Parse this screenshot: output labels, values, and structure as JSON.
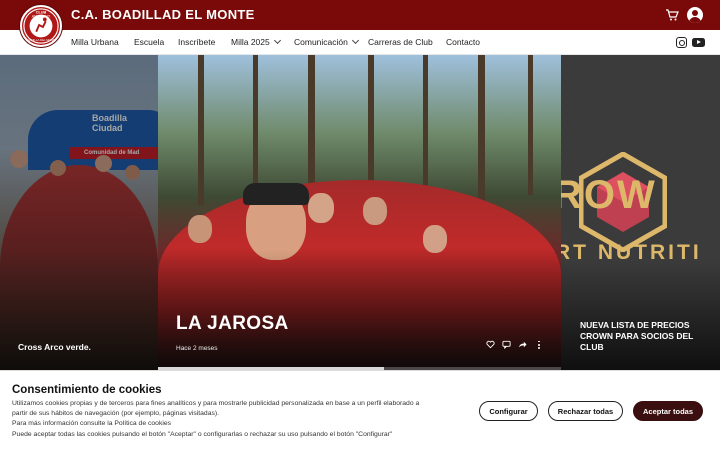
{
  "header": {
    "site_title": "C.A. BOADILLAD EL MONTE",
    "logo_name": "club-logo",
    "logo_text_top": "CLUB",
    "logo_text_mid": "ATLETISMO",
    "logo_text_bottom": "BOADILLA DEL MONTE",
    "cart_icon": "cart-icon",
    "user_icon": "user-account-icon",
    "colors": {
      "primary": "#7a0a0a",
      "nav_bg": "#ffffff"
    }
  },
  "nav": {
    "items": [
      {
        "label": "Milla Urbana",
        "has_dropdown": false
      },
      {
        "label": "Escuela",
        "has_dropdown": false
      },
      {
        "label": "Inscríbete",
        "has_dropdown": false
      },
      {
        "label": "Milla 2025",
        "has_dropdown": true
      },
      {
        "label": "Comunicación",
        "has_dropdown": true
      },
      {
        "label": "Carreras de Club",
        "has_dropdown": false
      },
      {
        "label": "Contacto",
        "has_dropdown": false
      }
    ],
    "social": [
      "instagram-icon",
      "youtube-icon"
    ]
  },
  "carousel": {
    "left_slide": {
      "caption": "Cross Arco verde.",
      "arch_text": "Boadilla\nCiudad",
      "banner_text": "Comunidad de Mad"
    },
    "center_slide": {
      "title": "LA JAROSA",
      "time": "Hace 2 meses",
      "progress": 0.56,
      "actions": [
        "heart-icon",
        "comment-icon",
        "share-icon",
        "more-options-icon"
      ]
    },
    "right_slide": {
      "brand_text": "ROW",
      "brand_sub": "RT NUTRITI",
      "caption": "NUEVA LISTA DE PRECIOS CROWN PARA SOCIOS DEL CLUB"
    }
  },
  "cookie_banner": {
    "title": "Consentimiento de cookies",
    "lines": [
      "Utilizamos cookies propias y de terceros para fines analíticos y para mostrarle publicidad personalizada en base a un perfil elaborado a",
      "partir de sus hábitos de navegación (por ejemplo, páginas visitadas).",
      "Para más información consulte la Política de cookies",
      "Puede aceptar todas las cookies pulsando el botón \"Aceptar\" o configurarlas o rechazar su uso pulsando el botón \"Configurar\""
    ],
    "btn_configure": "Configurar",
    "btn_reject": "Rechazar todas",
    "btn_accept": "Aceptar todas",
    "colors": {
      "accept_bg": "#3b0f0f"
    }
  }
}
